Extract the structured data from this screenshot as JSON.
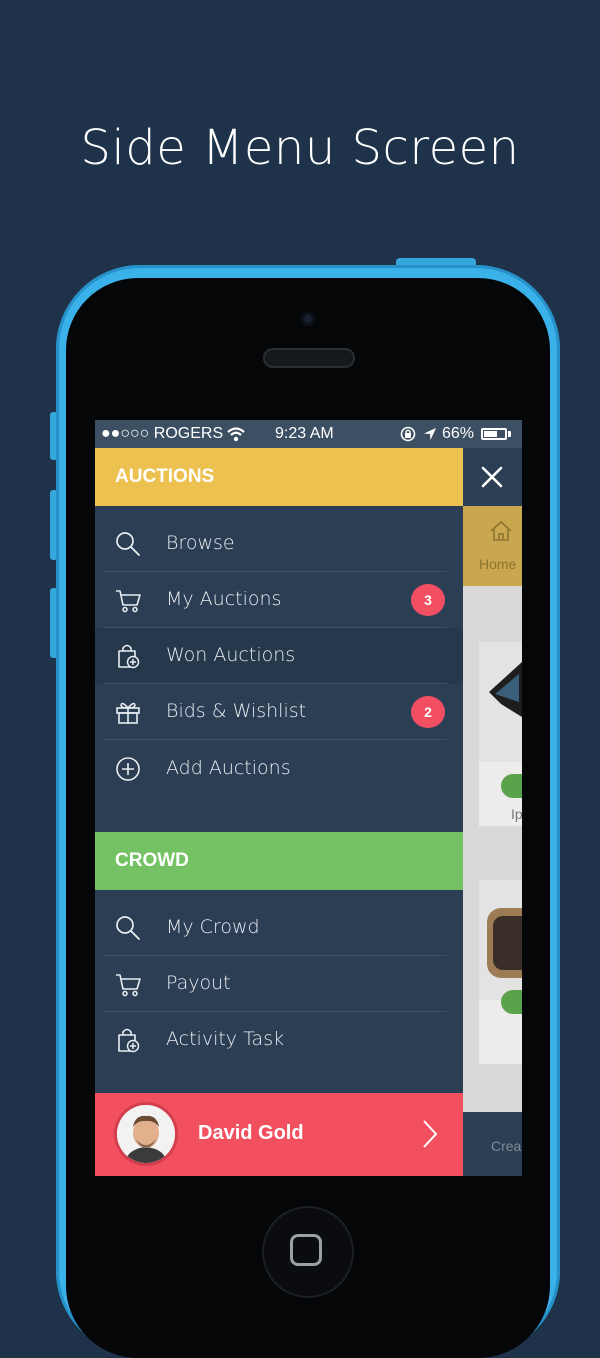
{
  "page": {
    "title": "Side Menu Screen"
  },
  "status_bar": {
    "carrier": "●●○○○ ROGERS",
    "time": "9:23 AM",
    "battery": "66%",
    "battery_level": 0.66
  },
  "drawer": {
    "auctions": {
      "header": "AUCTIONS",
      "color": "#ecc14f",
      "items": [
        {
          "label": "Browse",
          "icon": "search-icon"
        },
        {
          "label": "My Auctions",
          "icon": "cart-icon",
          "badge": "3"
        },
        {
          "label": "Won Auctions",
          "icon": "shopping-bag-plus-icon"
        },
        {
          "label": "Bids & Wishlist",
          "icon": "gift-icon",
          "badge": "2"
        },
        {
          "label": "Add Auctions",
          "icon": "plus-circle-icon"
        }
      ]
    },
    "crowd": {
      "header": "CROWD",
      "color": "#74c264",
      "items": [
        {
          "label": "My Crowd",
          "icon": "search-icon"
        },
        {
          "label": "Payout",
          "icon": "cart-icon"
        },
        {
          "label": "Activity Task",
          "icon": "shopping-bag-plus-icon"
        }
      ]
    },
    "user": {
      "name": "David Gold",
      "bar_color": "#f24f5f"
    }
  },
  "behind": {
    "home_label": "Home",
    "card1_text": "Ip",
    "footer_text": "Crea"
  },
  "colors": {
    "background": "#1e3349",
    "phone": "#3ab1e9",
    "drawer": "#2c3e53",
    "badge": "#f25062"
  }
}
